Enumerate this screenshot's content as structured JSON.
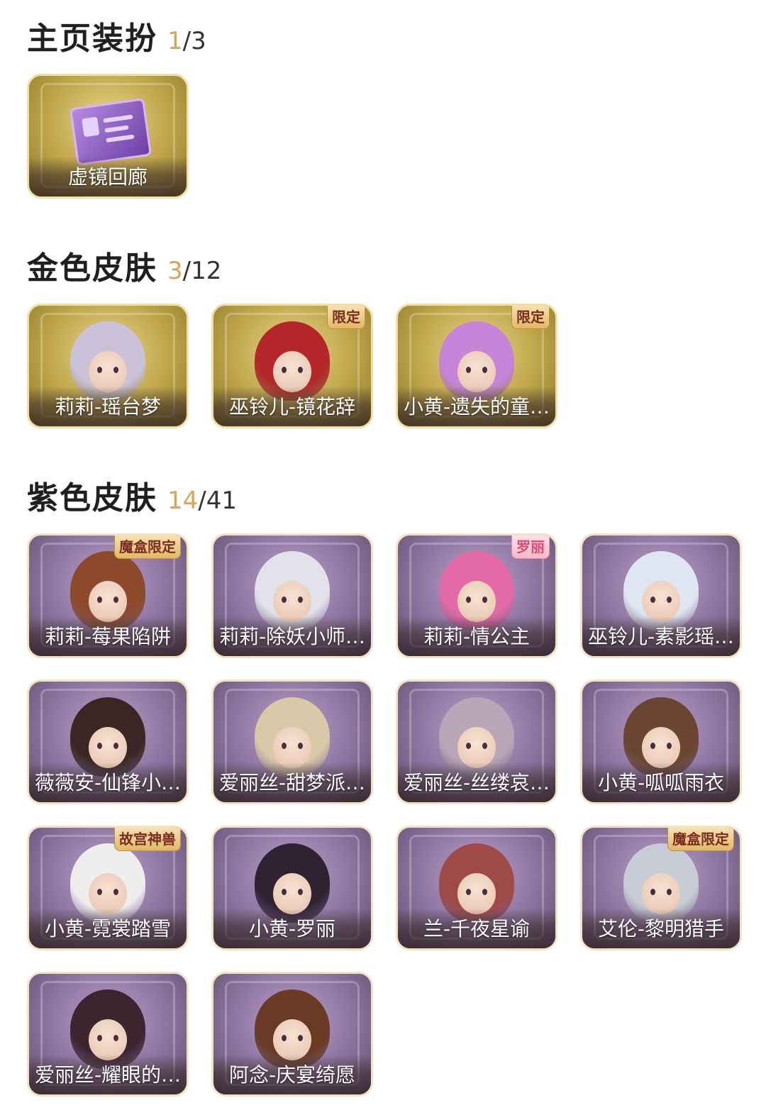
{
  "sections": [
    {
      "title": "主页装扮",
      "owned": "1",
      "total": "/3",
      "items": [
        {
          "name": "虚镜回廊",
          "rarity": "gold",
          "icon": "card-icon",
          "badge": ""
        }
      ]
    },
    {
      "title": "金色皮肤",
      "owned": "3",
      "total": "/12",
      "items": [
        {
          "name": "莉莉-瑶台梦",
          "rarity": "gold",
          "hair": "#c9c2d8",
          "badge": ""
        },
        {
          "name": "巫铃儿-镜花辞",
          "rarity": "gold",
          "hair": "#b3262a",
          "badge": "限定"
        },
        {
          "name": "小黄-遗失的童…",
          "rarity": "gold",
          "hair": "#c784d8",
          "badge": "限定"
        }
      ]
    },
    {
      "title": "紫色皮肤",
      "owned": "14",
      "total": "/41",
      "items": [
        {
          "name": "莉莉-莓果陷阱",
          "rarity": "purple",
          "hair": "#8c4a2a",
          "badge": "魔盒限定"
        },
        {
          "name": "莉莉-除妖小师…",
          "rarity": "purple",
          "hair": "#e2e2ea",
          "badge": ""
        },
        {
          "name": "莉莉-情公主",
          "rarity": "purple",
          "hair": "#e36aa6",
          "badge": "罗丽",
          "badge_style": "love"
        },
        {
          "name": "巫铃儿-素影瑶…",
          "rarity": "purple",
          "hair": "#dfe6f2",
          "badge": ""
        },
        {
          "name": "薇薇安-仙锋小…",
          "rarity": "purple",
          "hair": "#3a2622",
          "badge": ""
        },
        {
          "name": "爱丽丝-甜梦派…",
          "rarity": "purple",
          "hair": "#d9c9a8",
          "badge": ""
        },
        {
          "name": "爱丽丝-丝缕哀…",
          "rarity": "purple",
          "hair": "#b7a7b8",
          "badge": ""
        },
        {
          "name": "小黄-呱呱雨衣",
          "rarity": "purple",
          "hair": "#6a4630",
          "badge": ""
        },
        {
          "name": "小黄-霓裳踏雪",
          "rarity": "purple",
          "hair": "#eeeeee",
          "badge": "故宫神兽"
        },
        {
          "name": "小黄-罗丽",
          "rarity": "purple",
          "hair": "#2e2233",
          "badge": ""
        },
        {
          "name": "兰-千夜星谕",
          "rarity": "purple",
          "hair": "#a04a48",
          "badge": ""
        },
        {
          "name": "艾伦-黎明猎手",
          "rarity": "purple",
          "hair": "#c8ccd6",
          "badge": "魔盒限定"
        },
        {
          "name": "爱丽丝-耀眼的…",
          "rarity": "purple",
          "hair": "#3d2530",
          "badge": ""
        },
        {
          "name": "阿念-庆宴绮愿",
          "rarity": "purple",
          "hair": "#6a3a24",
          "badge": ""
        }
      ]
    }
  ]
}
